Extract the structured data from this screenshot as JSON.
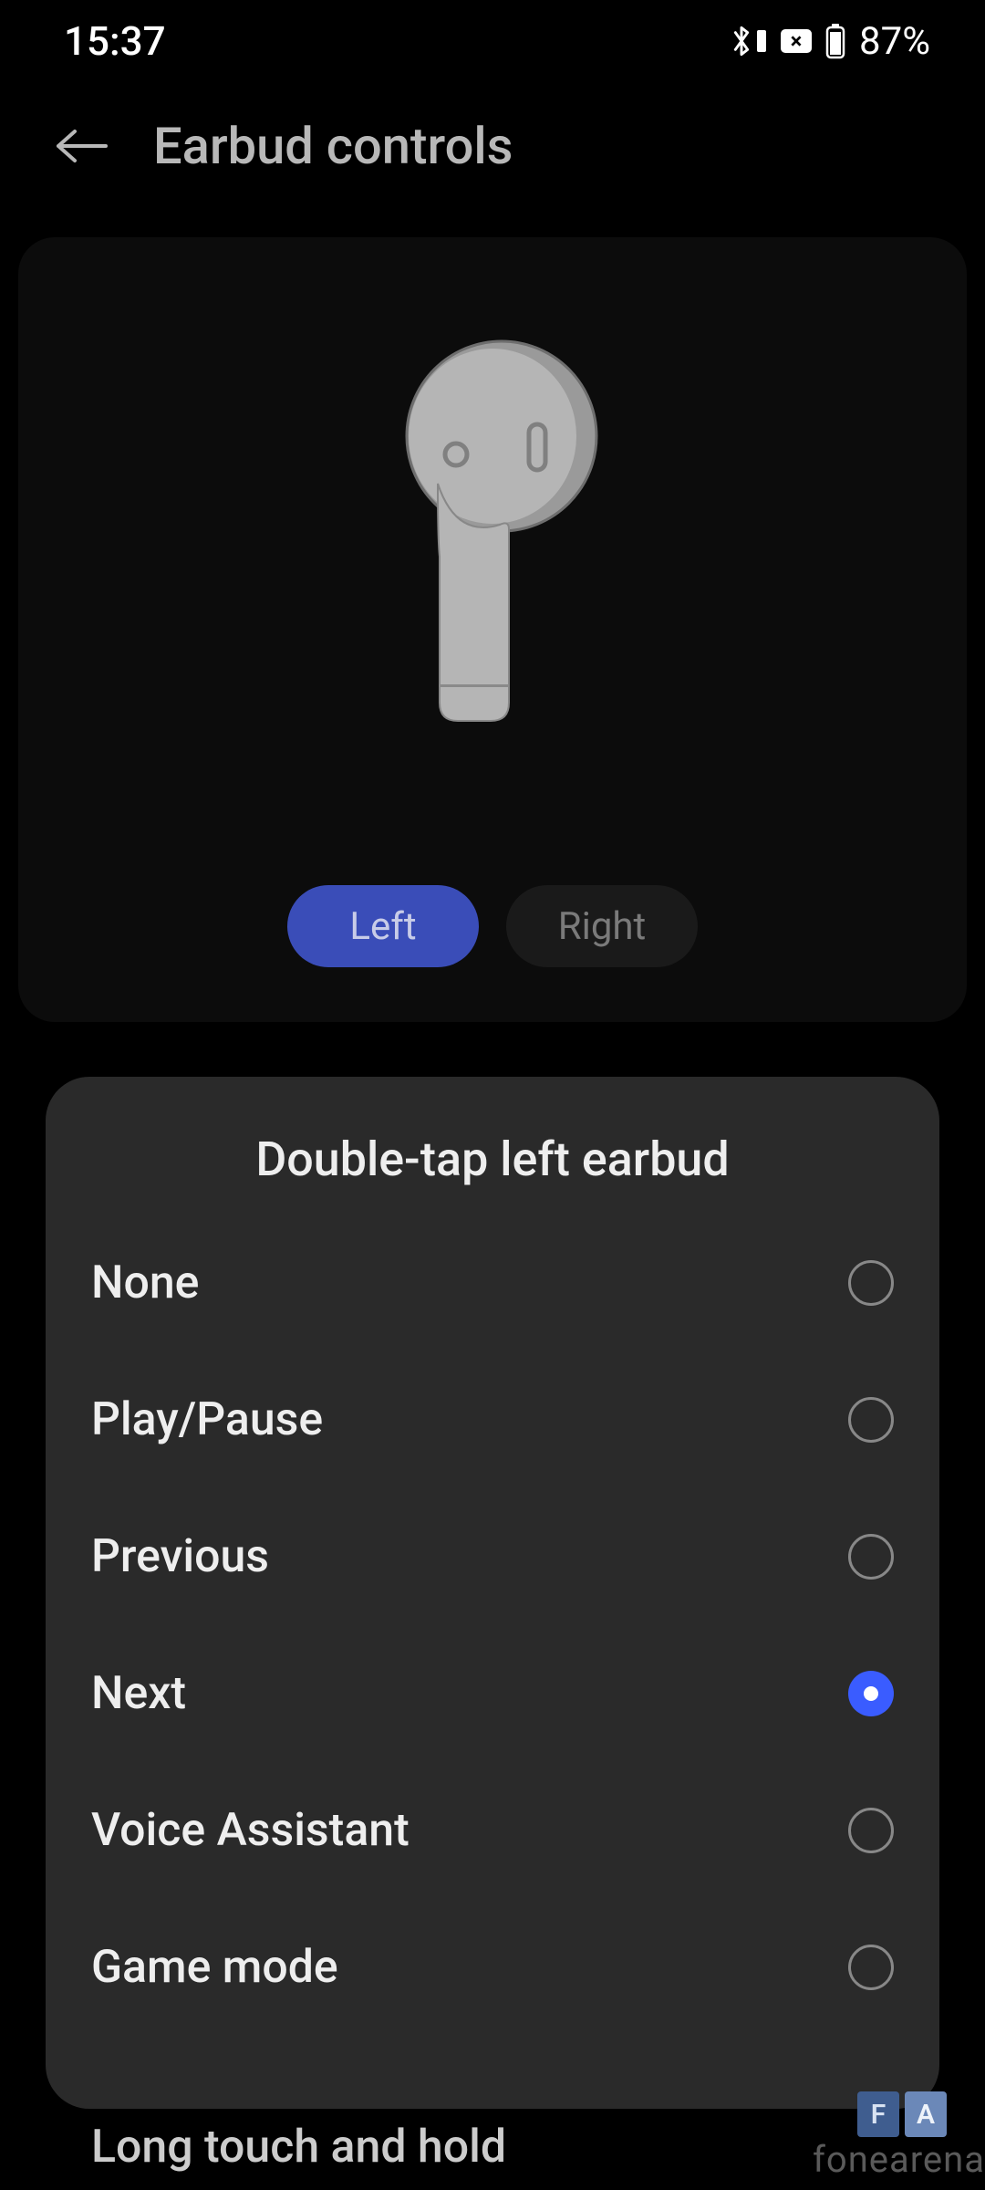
{
  "status": {
    "time": "15:37",
    "battery_text": "87%"
  },
  "header": {
    "title": "Earbud controls"
  },
  "tabs": {
    "left": "Left",
    "right": "Right"
  },
  "sheet": {
    "title": "Double-tap left earbud",
    "options": [
      {
        "label": "None",
        "selected": false
      },
      {
        "label": "Play/Pause",
        "selected": false
      },
      {
        "label": "Previous",
        "selected": false
      },
      {
        "label": "Next",
        "selected": true
      },
      {
        "label": "Voice Assistant",
        "selected": false
      },
      {
        "label": "Game mode",
        "selected": false
      }
    ]
  },
  "bottom_peek": "Long touch and hold",
  "watermark": "fonearena"
}
